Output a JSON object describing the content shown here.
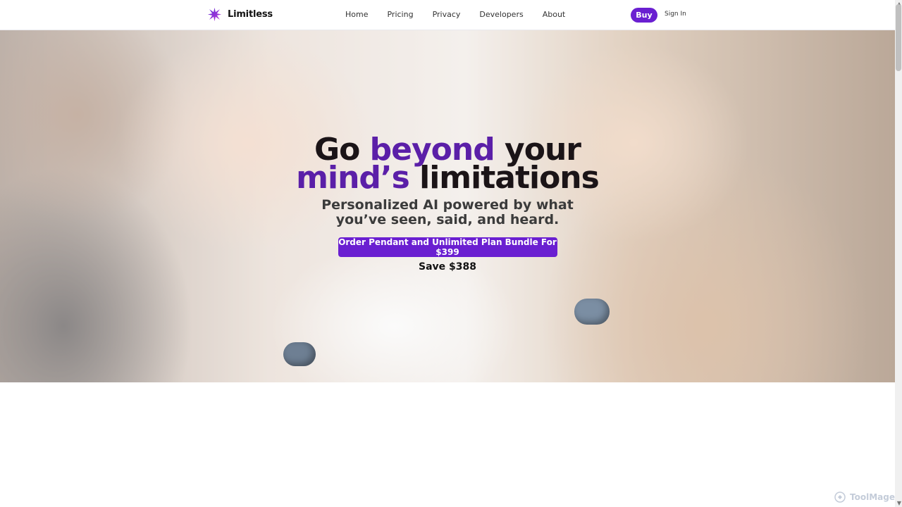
{
  "brand": {
    "name": "Limitless"
  },
  "nav": {
    "items": [
      "Home",
      "Pricing",
      "Privacy",
      "Developers",
      "About"
    ]
  },
  "actions": {
    "buy": "Buy",
    "signin": "Sign In"
  },
  "hero": {
    "headline_line1_part1": "Go ",
    "headline_line1_accent": "beyond",
    "headline_line1_part2": " your",
    "headline_line2_accent": "mind’s",
    "headline_line2_part2": " limitations",
    "subtitle_line1": "Personalized AI powered by what",
    "subtitle_line2": "you’ve seen, said, and heard.",
    "cta": "Order Pendant and Unlimited Plan Bundle For $399",
    "save": "Save $388"
  },
  "watermark": {
    "text": "ToolMage"
  },
  "colors": {
    "accent": "#6a1fd1"
  },
  "icons": {
    "brand_logo": "star-burst-icon",
    "watermark_logo": "toolmage-logo"
  }
}
